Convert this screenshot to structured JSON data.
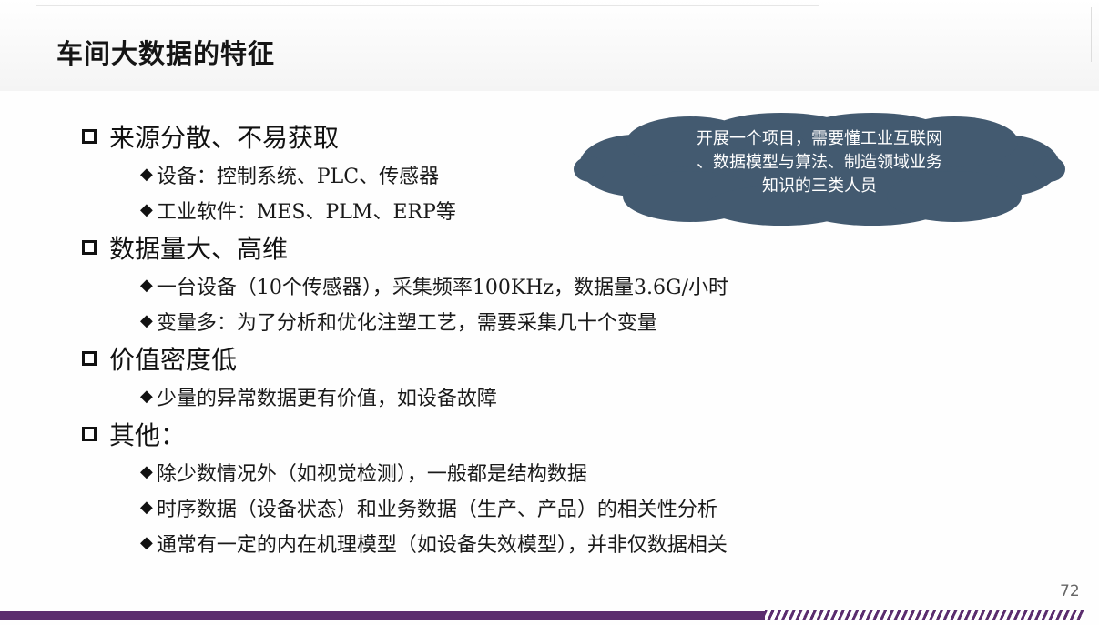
{
  "slide": {
    "title": "车间大数据的特征",
    "page_number": "72"
  },
  "sections": [
    {
      "label": "来源分散、不易获取",
      "bullets": [
        "设备：控制系统、PLC、传感器",
        "工业软件：MES、PLM、ERP等"
      ]
    },
    {
      "label": "数据量大、高维",
      "bullets": [
        "一台设备（10个传感器），采集频率100KHz，数据量3.6G/小时",
        "变量多：为了分析和优化注塑工艺，需要采集几十个变量"
      ]
    },
    {
      "label": "价值密度低",
      "bullets": [
        "少量的异常数据更有价值，如设备故障"
      ]
    },
    {
      "label": "其他：",
      "bullets": [
        "除少数情况外（如视觉检测），一般都是结构数据",
        "时序数据（设备状态）和业务数据（生产、产品）的相关性分析",
        "通常有一定的内在机理模型（如设备失效模型），并非仅数据相关"
      ]
    }
  ],
  "callout": {
    "lines": [
      "开展一个项目，需要懂工业互联网",
      "、数据模型与算法、制造领域业务",
      "知识的三类人员"
    ]
  },
  "colors": {
    "cloud_fill": "#435a70",
    "footer_accent": "#5b2d6e"
  },
  "icons": {
    "section_marker": "checkbox-square-icon",
    "bullet_marker": "diamond-bullet-icon"
  }
}
